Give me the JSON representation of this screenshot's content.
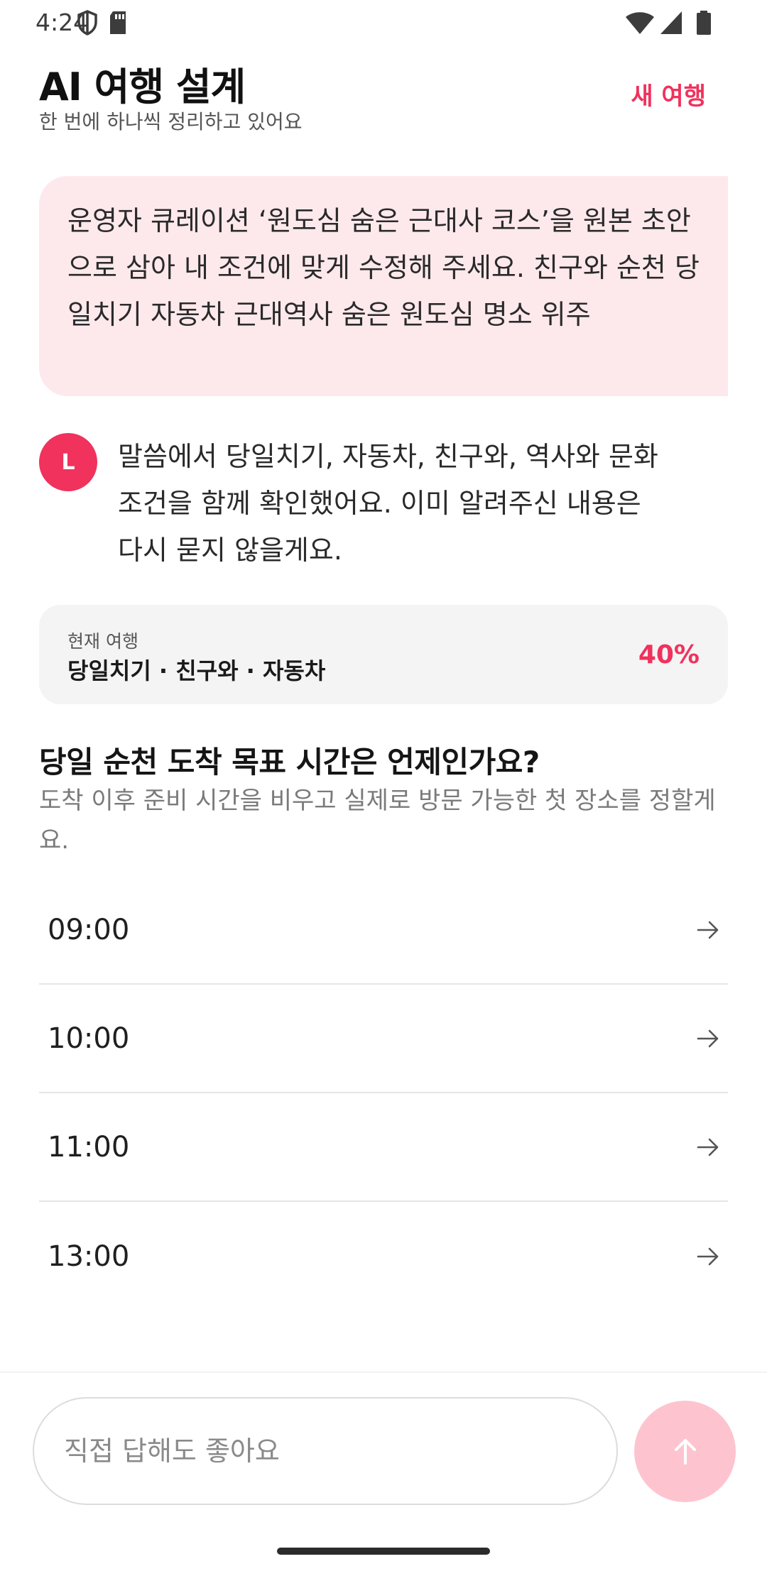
{
  "status_bar": {
    "time": "4:24",
    "icons": [
      "shield-icon",
      "sd-card-icon",
      "wifi-icon",
      "signal-icon",
      "battery-icon"
    ]
  },
  "header": {
    "title": "AI 여행 설계",
    "subtitle": "한 번에 하나씩 정리하고 있어요",
    "new_trip_label": "새 여행"
  },
  "messages": {
    "user_text": "운영자 큐레이션 ‘원도심 숨은 근대사 코스’을 원본 초안으로 삼아 내 조건에 맞게 수정해 주세요. 친구와 순천 당일치기 자동차 근대역사 숨은 원도심 명소 위주",
    "assistant_avatar_letter": "L",
    "assistant_text": "말씀에서 당일치기, 자동차, 친구와, 역사와 문화 조건을 함께 확인했어요. 이미 알려주신 내용은 다시 묻지 않을게요."
  },
  "current_trip": {
    "label": "현재 여행",
    "value": "당일치기 · 친구와 · 자동차",
    "progress_text": "40%",
    "progress_fraction": 0.4
  },
  "question": {
    "title": "당일 순천 도착 목표 시간은 언제인가요?",
    "description": "도착 이후 준비 시간을 비우고 실제로 방문 가능한 첫 장소를 정할게요."
  },
  "options": [
    {
      "label": "09:00"
    },
    {
      "label": "10:00"
    },
    {
      "label": "11:00"
    },
    {
      "label": "13:00"
    }
  ],
  "composer": {
    "placeholder": "직접 답해도 좋아요",
    "send_icon": "arrow-up-icon"
  },
  "colors": {
    "accent": "#f0325d",
    "user_bubble": "#fde9ec",
    "send_button": "#fdc4cf",
    "card_bg": "#f4f4f5"
  }
}
